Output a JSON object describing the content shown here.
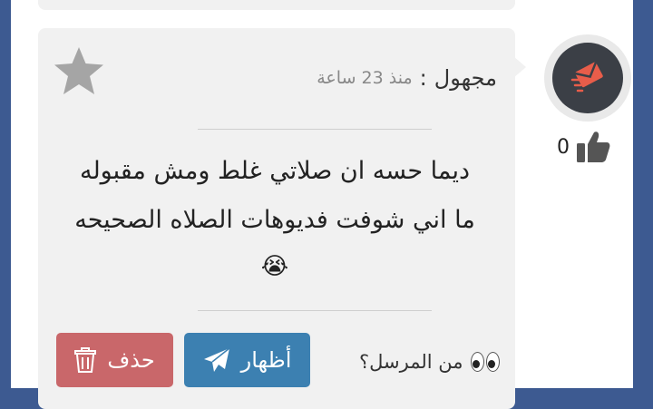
{
  "message": {
    "author": "مجهول",
    "separator": ":",
    "time": "منذ 23 ساعة",
    "text_line_1": "ديما حسه ان صلاتي غلط ومش مقبوله",
    "text_line_2": "ما اني شوفت فديوهات الصلاه الصحيحه",
    "emoji": "😭",
    "likes": "0"
  },
  "actions": {
    "show_label": "أظهار",
    "delete_label": "حذف",
    "reveal_sender_question": "من المرسل؟"
  },
  "icons": {
    "avatar": "envelope-icon",
    "like": "thumbs-up-icon",
    "favorite": "star-icon",
    "show": "paper-plane-icon",
    "delete": "trash-icon",
    "eyes": "eyes-icon"
  },
  "colors": {
    "header_blue": "#3d5a91",
    "card_bg": "#f1f1f1",
    "avatar_bg": "#3b3f46",
    "avatar_accent": "#e85d4a",
    "show_button": "#3c80b1",
    "delete_button": "#c9676a",
    "star": "#a5a5a5"
  }
}
